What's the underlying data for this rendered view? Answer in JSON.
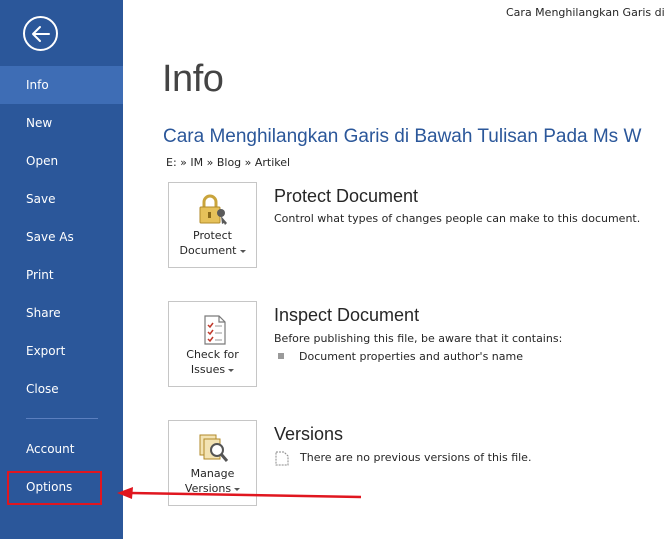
{
  "window": {
    "title": "Cara Menghilangkan Garis di B"
  },
  "sidebar": {
    "back_icon": "back-arrow-icon",
    "items": [
      {
        "label": "Info",
        "active": true
      },
      {
        "label": "New"
      },
      {
        "label": "Open"
      },
      {
        "label": "Save"
      },
      {
        "label": "Save As"
      },
      {
        "label": "Print"
      },
      {
        "label": "Share"
      },
      {
        "label": "Export"
      },
      {
        "label": "Close"
      },
      {
        "label": "Account"
      },
      {
        "label": "Options",
        "highlighted": true
      }
    ]
  },
  "main": {
    "page_title": "Info",
    "doc_title": "Cara Menghilangkan Garis di Bawah Tulisan Pada Ms W",
    "doc_path": "E: » IM » Blog » Artikel",
    "sections": [
      {
        "tile_line1": "Protect",
        "tile_line2": "Document",
        "tile_icon": "lock-key-icon",
        "heading": "Protect Document",
        "description": "Control what types of changes people can make to this document."
      },
      {
        "tile_line1": "Check for",
        "tile_line2": "Issues",
        "tile_icon": "checklist-icon",
        "heading": "Inspect Document",
        "description": "Before publishing this file, be aware that it contains:",
        "bullets": [
          "Document properties and author's name"
        ]
      },
      {
        "tile_line1": "Manage",
        "tile_line2": "Versions",
        "tile_icon": "versions-search-icon",
        "heading": "Versions",
        "description": "There are no previous versions of this file."
      }
    ]
  },
  "annotation": {
    "highlight_color": "#e0161f",
    "arrow_icon": "red-arrow-left"
  },
  "colors": {
    "sidebar_bg": "#2b579a",
    "sidebar_active": "#3e6db5",
    "doc_title": "#2b579a"
  }
}
